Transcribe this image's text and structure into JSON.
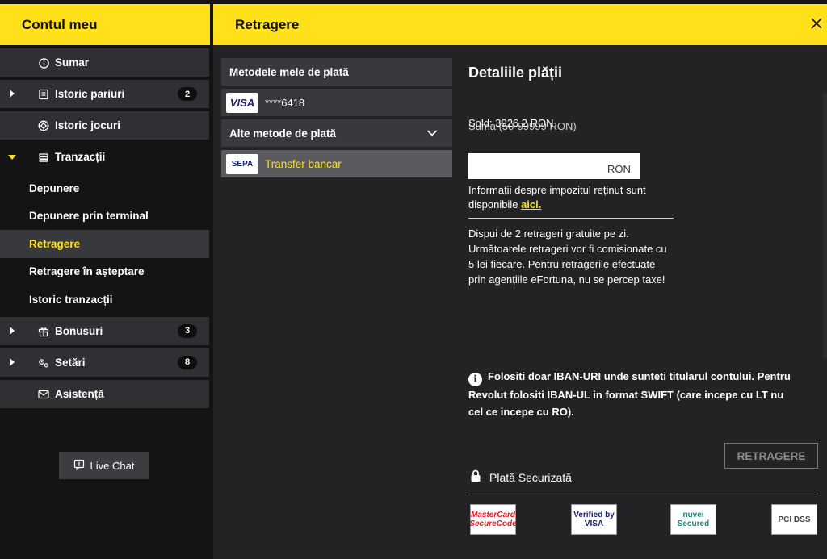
{
  "sidebar": {
    "title": "Contul meu",
    "items": [
      {
        "label": "Sumar",
        "icon": "info-icon"
      },
      {
        "label": "Istoric pariuri",
        "icon": "ticket-icon",
        "badge": "2"
      },
      {
        "label": "Istoric jocuri",
        "icon": "chip-icon"
      },
      {
        "label": "Tranzacții",
        "icon": "wallet-icon"
      },
      {
        "label": "Bonusuri",
        "icon": "gift-icon",
        "badge": "3"
      },
      {
        "label": "Setări",
        "icon": "gears-icon",
        "badge": "8"
      },
      {
        "label": "Asistență",
        "icon": "mail-icon"
      }
    ],
    "sub_items": [
      {
        "label": "Depunere"
      },
      {
        "label": "Depunere prin terminal"
      },
      {
        "label": "Retragere"
      },
      {
        "label": "Retragere în așteptare"
      },
      {
        "label": "Istoric tranzacții"
      }
    ],
    "live_chat": "Live Chat"
  },
  "main": {
    "title": "Retragere"
  },
  "payment": {
    "my_methods": "Metodele mele de plată",
    "card_masked": "****6418",
    "card_logo": "VISA",
    "other_methods": "Alte metode de plată",
    "bank_transfer": "Transfer bancar",
    "bank_logo": "SEPA"
  },
  "details": {
    "title": "Detaliile plății",
    "balance": "Sold: 3926,2 RON",
    "amount_label": "Suma (50-99999 RON)",
    "amount_value": "",
    "amount_unit": "RON",
    "tax_info": "Informații despre impozitul reținut sunt disponibile",
    "tax_link": "aici.",
    "free_info": "Dispui de 2 retrageri gratuite pe zi. Următoarele retrageri vor fi comisionate cu 5 lei fiecare. Pentru retragerile efectuate prin agențiile eFortuna, nu se percep taxe!",
    "iban_note": "Folositi doar IBAN-URI unde sunteti titularul contului. Pentru Revolut folositi IBAN-UL in format SWIFT (care incepe cu LT nu cel ce incepe cu RO).",
    "withdraw_button": "RETRAGERE",
    "secure_label": "Plată Securizată",
    "logos": [
      "MasterCard SecureCode",
      "Verified by VISA",
      "nuvei Secured",
      "PCI DSS"
    ]
  },
  "colors": {
    "accent": "#ffe01b",
    "sidebar_bg": "#141414",
    "panel_bg": "#232325",
    "row_bg": "#38393c"
  }
}
